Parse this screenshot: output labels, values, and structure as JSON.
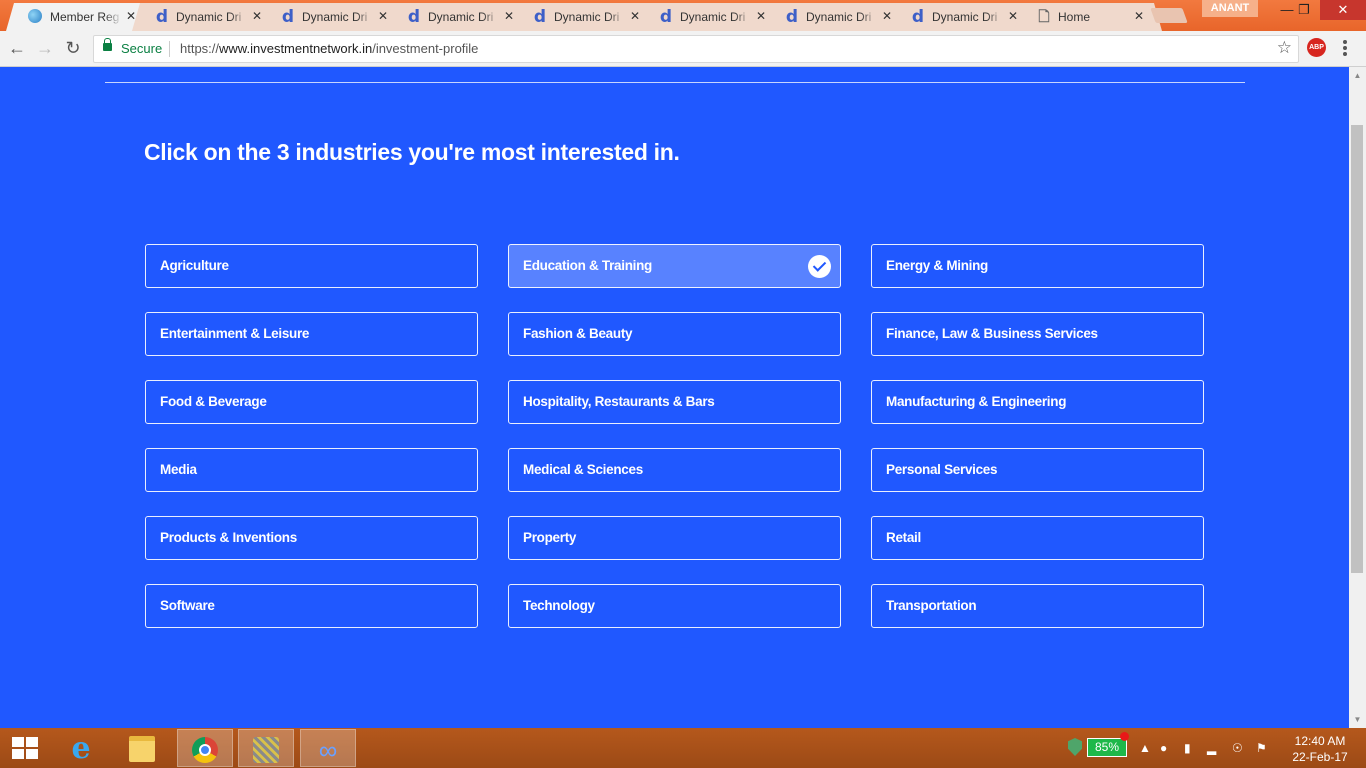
{
  "browser": {
    "tabs": [
      {
        "title": "Member Reg",
        "favicon": "ie-icon",
        "active": true
      },
      {
        "title": "Dynamic Dri",
        "favicon": "d-icon"
      },
      {
        "title": "Dynamic Dri",
        "favicon": "d-icon"
      },
      {
        "title": "Dynamic Dri",
        "favicon": "d-icon"
      },
      {
        "title": "Dynamic Dri",
        "favicon": "d-icon"
      },
      {
        "title": "Dynamic Dri",
        "favicon": "d-icon"
      },
      {
        "title": "Dynamic Dri",
        "favicon": "d-icon"
      },
      {
        "title": "Dynamic Dri",
        "favicon": "d-icon"
      },
      {
        "title": "Home",
        "favicon": "document-icon"
      }
    ],
    "profile_name": "ANANT",
    "security_label": "Secure",
    "url_scheme": "https://",
    "url_host": "www.investmentnetwork.in",
    "url_path": "/investment-profile",
    "extension_badge": "ABP"
  },
  "page": {
    "heading": "Click on the 3 industries you're most interested in.",
    "industries": [
      {
        "label": "Agriculture",
        "selected": false
      },
      {
        "label": "Education & Training",
        "selected": true
      },
      {
        "label": "Energy & Mining",
        "selected": false
      },
      {
        "label": "Entertainment & Leisure",
        "selected": false
      },
      {
        "label": "Fashion & Beauty",
        "selected": false
      },
      {
        "label": "Finance, Law & Business Services",
        "selected": false
      },
      {
        "label": "Food & Beverage",
        "selected": false
      },
      {
        "label": "Hospitality, Restaurants & Bars",
        "selected": false
      },
      {
        "label": "Manufacturing & Engineering",
        "selected": false
      },
      {
        "label": "Media",
        "selected": false
      },
      {
        "label": "Medical & Sciences",
        "selected": false
      },
      {
        "label": "Personal Services",
        "selected": false
      },
      {
        "label": "Products & Inventions",
        "selected": false
      },
      {
        "label": "Property",
        "selected": false
      },
      {
        "label": "Retail",
        "selected": false
      },
      {
        "label": "Software",
        "selected": false
      },
      {
        "label": "Technology",
        "selected": false
      },
      {
        "label": "Transportation",
        "selected": false
      }
    ],
    "colors": {
      "background": "#2058ff",
      "border": "#ffffff"
    }
  },
  "taskbar": {
    "battery": "85%",
    "time": "12:40 AM",
    "date": "22-Feb-17"
  }
}
